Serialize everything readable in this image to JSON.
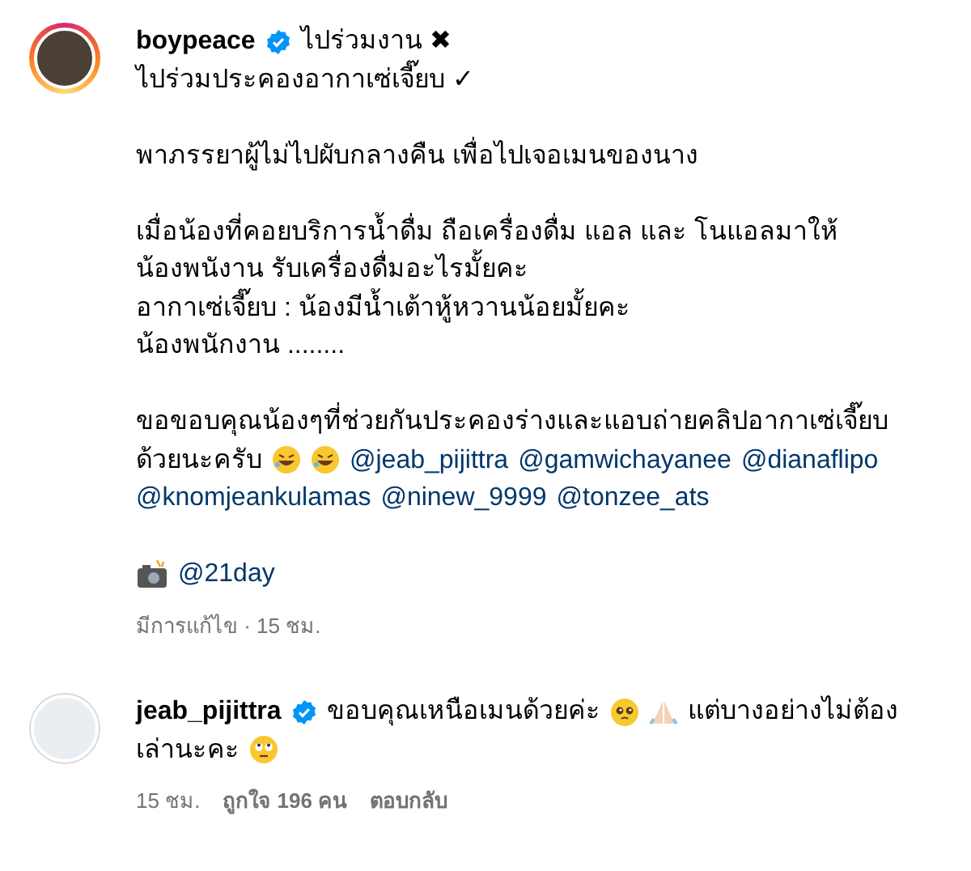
{
  "post": {
    "username": "boypeace",
    "verified": true,
    "paragraphs": [
      [
        [
          {
            "kind": "text",
            "text": "ไปร่วมงาน ✖"
          }
        ],
        [
          {
            "kind": "text",
            "text": "ไปร่วมประคองอากาเซ่เจี๊ยบ ✓"
          }
        ]
      ],
      [
        [
          {
            "kind": "text",
            "text": "พาภรรยาผู้ไม่ไปผับกลางคืน เพื่อไปเจอเมนของนาง"
          }
        ]
      ],
      [
        [
          {
            "kind": "text",
            "text": "เมื่อน้องที่คอยบริการน้ำดื่ม ถือเครื่องดื่ม แอล และ โนแอลมาให้"
          }
        ],
        [
          {
            "kind": "text",
            "text": "น้องพนังาน รับเครื่องดื่มอะไรมั้ยคะ"
          }
        ],
        [
          {
            "kind": "text",
            "text": "อากาเซ่เจี๊ยบ : น้องมีน้ำเต้าหู้หวานน้อยมั้ยคะ"
          }
        ],
        [
          {
            "kind": "text",
            "text": "น้องพนักงาน ........"
          }
        ]
      ],
      [
        [
          {
            "kind": "text",
            "text": "ขอขอบคุณน้องๆที่ช่วยกันประคองร่างและแอบถ่ายคลิปอากาเซ่เจี๊ยบ"
          }
        ],
        [
          {
            "kind": "text",
            "text": "ด้วยนะครับ"
          },
          {
            "kind": "laugh"
          },
          {
            "kind": "laugh"
          },
          {
            "kind": "mention",
            "text": "@jeab_pijittra"
          },
          {
            "kind": "mention",
            "text": "@gamwichayanee"
          },
          {
            "kind": "mention",
            "text": "@dianaflipo"
          }
        ],
        [
          {
            "kind": "mention",
            "text": "@knomjeankulamas"
          },
          {
            "kind": "mention",
            "text": "@ninew_9999"
          },
          {
            "kind": "mention",
            "text": "@tonzee_ats"
          }
        ]
      ],
      [
        [
          {
            "kind": "camera"
          },
          {
            "kind": "mention",
            "text": "@21day"
          }
        ]
      ]
    ],
    "meta": "มีการแก้ไข · 15 ชม."
  },
  "comment": {
    "username": "jeab_pijittra",
    "verified": true,
    "paragraphs": [
      [
        [
          {
            "kind": "text",
            "text": "ขอบคุณเหนือเมนด้วยค่ะ"
          },
          {
            "kind": "plead"
          },
          {
            "kind": "pray"
          },
          {
            "kind": "text",
            "text": "แต่บางอย่างไม่ต้อง"
          }
        ],
        [
          {
            "kind": "text",
            "text": "เล่านะคะ"
          },
          {
            "kind": "rolleyes"
          }
        ]
      ]
    ],
    "time": "15 ชม.",
    "likes": "ถูกใจ 196 คน",
    "reply": "ตอบกลับ"
  }
}
